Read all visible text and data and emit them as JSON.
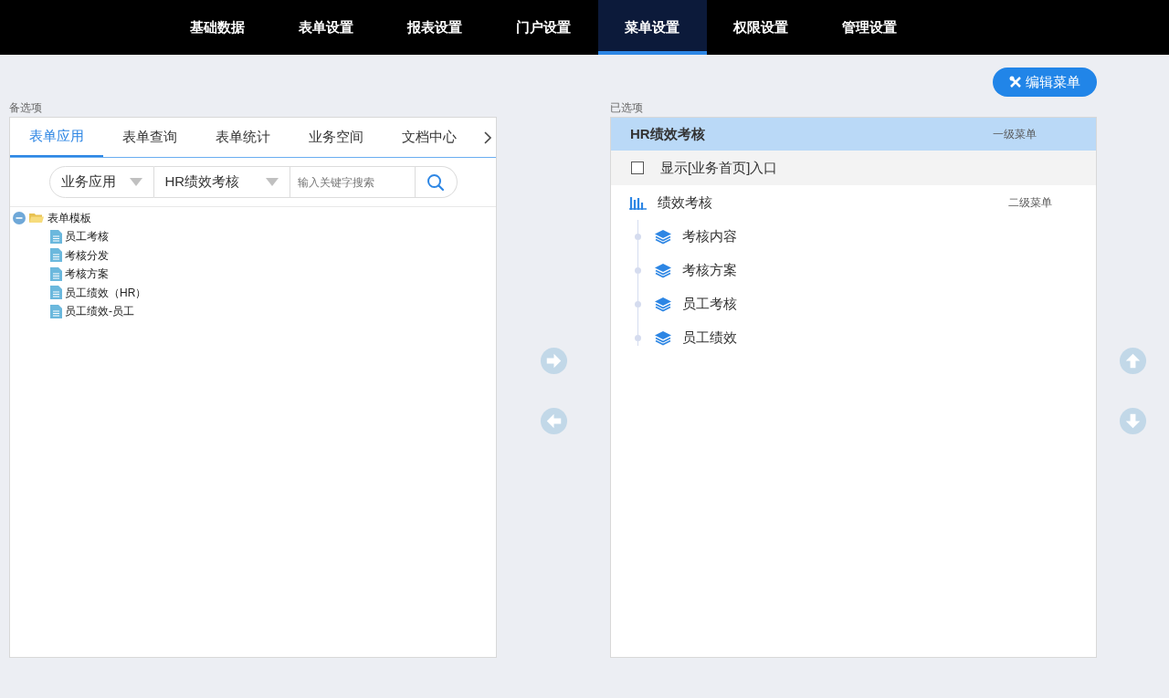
{
  "nav": [
    {
      "label": "基础数据",
      "selected": false
    },
    {
      "label": "表单设置",
      "selected": false
    },
    {
      "label": "报表设置",
      "selected": false
    },
    {
      "label": "门户设置",
      "selected": false
    },
    {
      "label": "菜单设置",
      "selected": true
    },
    {
      "label": "权限设置",
      "selected": false
    },
    {
      "label": "管理设置",
      "selected": false
    }
  ],
  "left": {
    "label": "备选项",
    "tabs": [
      {
        "label": "表单应用",
        "selected": true
      },
      {
        "label": "表单查询",
        "selected": false
      },
      {
        "label": "表单统计",
        "selected": false
      },
      {
        "label": "业务空间",
        "selected": false
      },
      {
        "label": "文档中心",
        "selected": false
      }
    ],
    "filter_1": "业务应用",
    "filter_2": "HR绩效考核",
    "search": {
      "placeholder": "输入关键字搜索"
    },
    "tree": [
      {
        "label": "表单模板",
        "expanded": true,
        "children": [
          {
            "label": "员工考核"
          },
          {
            "label": "考核分发"
          },
          {
            "label": "考核方案"
          },
          {
            "label": "员工绩效（HR）"
          },
          {
            "label": "员工绩效-员工"
          }
        ]
      }
    ]
  },
  "edit_button": "编辑菜单",
  "right": {
    "label": "已选项",
    "menu_title": "HR绩效考核",
    "menu_level": "一级菜单",
    "show_entry": {
      "label": "显示[业务首页]入口",
      "checked": false
    },
    "submenu": {
      "label": "绩效考核",
      "level": "二级菜单",
      "children": [
        {
          "label": "考核内容"
        },
        {
          "label": "考核方案"
        },
        {
          "label": "员工考核"
        },
        {
          "label": "员工绩效"
        }
      ]
    }
  }
}
